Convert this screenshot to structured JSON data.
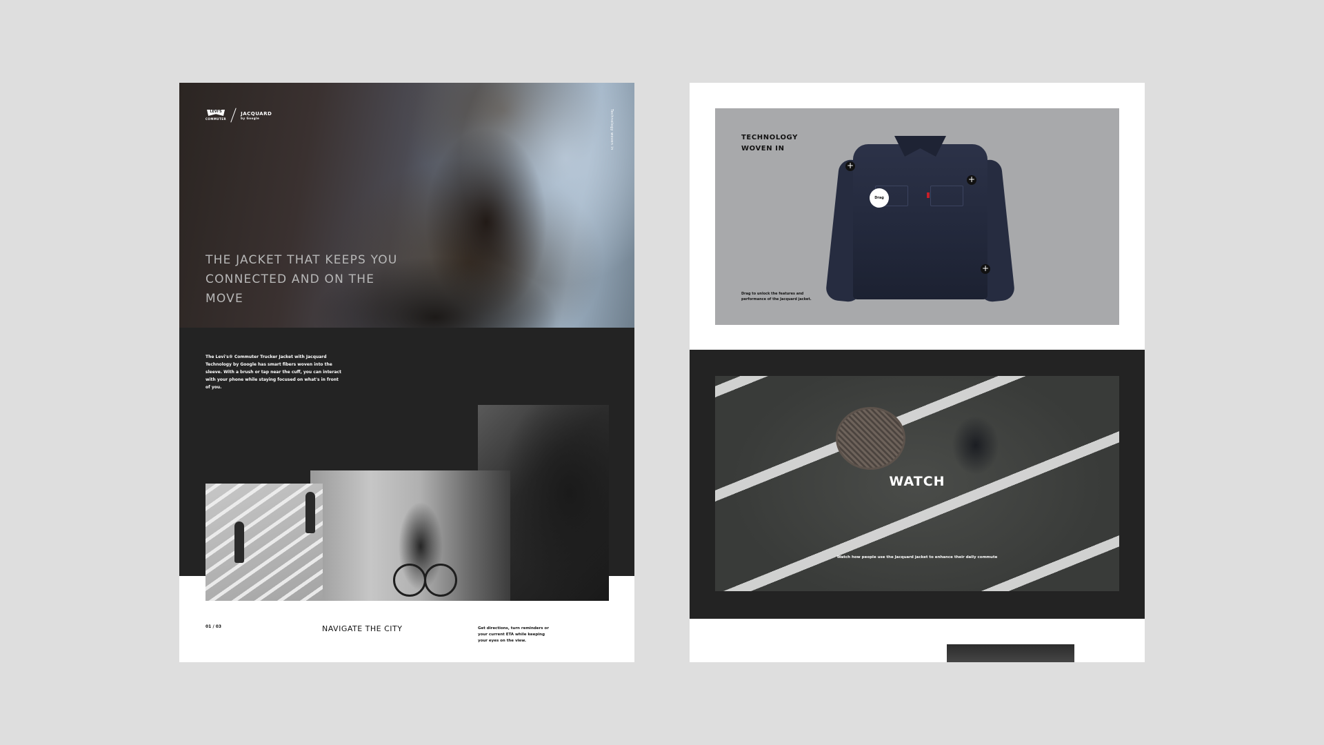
{
  "left_page": {
    "logo": {
      "brand": "LEVI'S",
      "brand_sub": "COMMUTER",
      "partner": "JACQUARD",
      "partner_sub": "by Google"
    },
    "vertical_tag": "Technology woven in",
    "hero_title": "THE JACKET THAT KEEPS YOU CONNECTED AND ON THE MOVE",
    "intro_text": "The Levi's® Commuter Trucker Jacket with Jacquard Technology by Google has smart fibers woven into the sleeve. With a brush or tap near the cuff, you can interact with your phone while staying focused on what's in front of you.",
    "pager": "01 / 03",
    "section_title": "NAVIGATE THE CITY",
    "section_desc": "Get directions, turn reminders or your current ETA while keeping your eyes on the view."
  },
  "right_page": {
    "tech_title": "TECHNOLOGY WOVEN IN",
    "drag_label": "Drag",
    "hotspot_symbol": "+",
    "tech_hint": "Drag to unlock the features and performance of the Jacquard jacket.",
    "watch_label": "WATCH",
    "watch_desc": "Watch how people use the Jacquard jacket to enhance their daily commute"
  },
  "colors": {
    "canvas": "#dedede",
    "dark_block": "#232323",
    "tech_panel": "#a8a9ab",
    "jacket_denim": "#22283b",
    "accent_red": "#c81e28"
  }
}
